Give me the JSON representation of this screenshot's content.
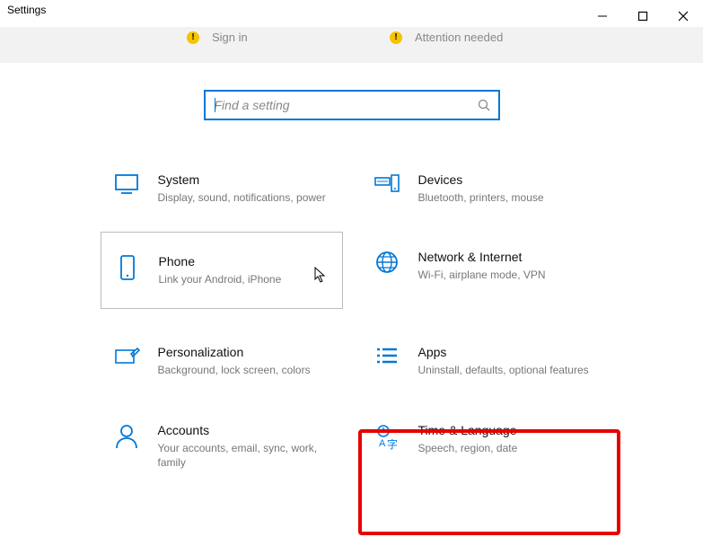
{
  "window": {
    "title": "Settings"
  },
  "header": {
    "status_left": "Sign in",
    "status_right": "Attention needed"
  },
  "search": {
    "placeholder": "Find a setting"
  },
  "tiles": {
    "system": {
      "title": "System",
      "desc": "Display, sound, notifications, power"
    },
    "devices": {
      "title": "Devices",
      "desc": "Bluetooth, printers, mouse"
    },
    "phone": {
      "title": "Phone",
      "desc": "Link your Android, iPhone"
    },
    "network": {
      "title": "Network & Internet",
      "desc": "Wi-Fi, airplane mode, VPN"
    },
    "personal": {
      "title": "Personalization",
      "desc": "Background, lock screen, colors"
    },
    "apps": {
      "title": "Apps",
      "desc": "Uninstall, defaults, optional features"
    },
    "accounts": {
      "title": "Accounts",
      "desc": "Your accounts, email, sync, work, family"
    },
    "timelang": {
      "title": "Time & Language",
      "desc": "Speech, region, date"
    }
  }
}
